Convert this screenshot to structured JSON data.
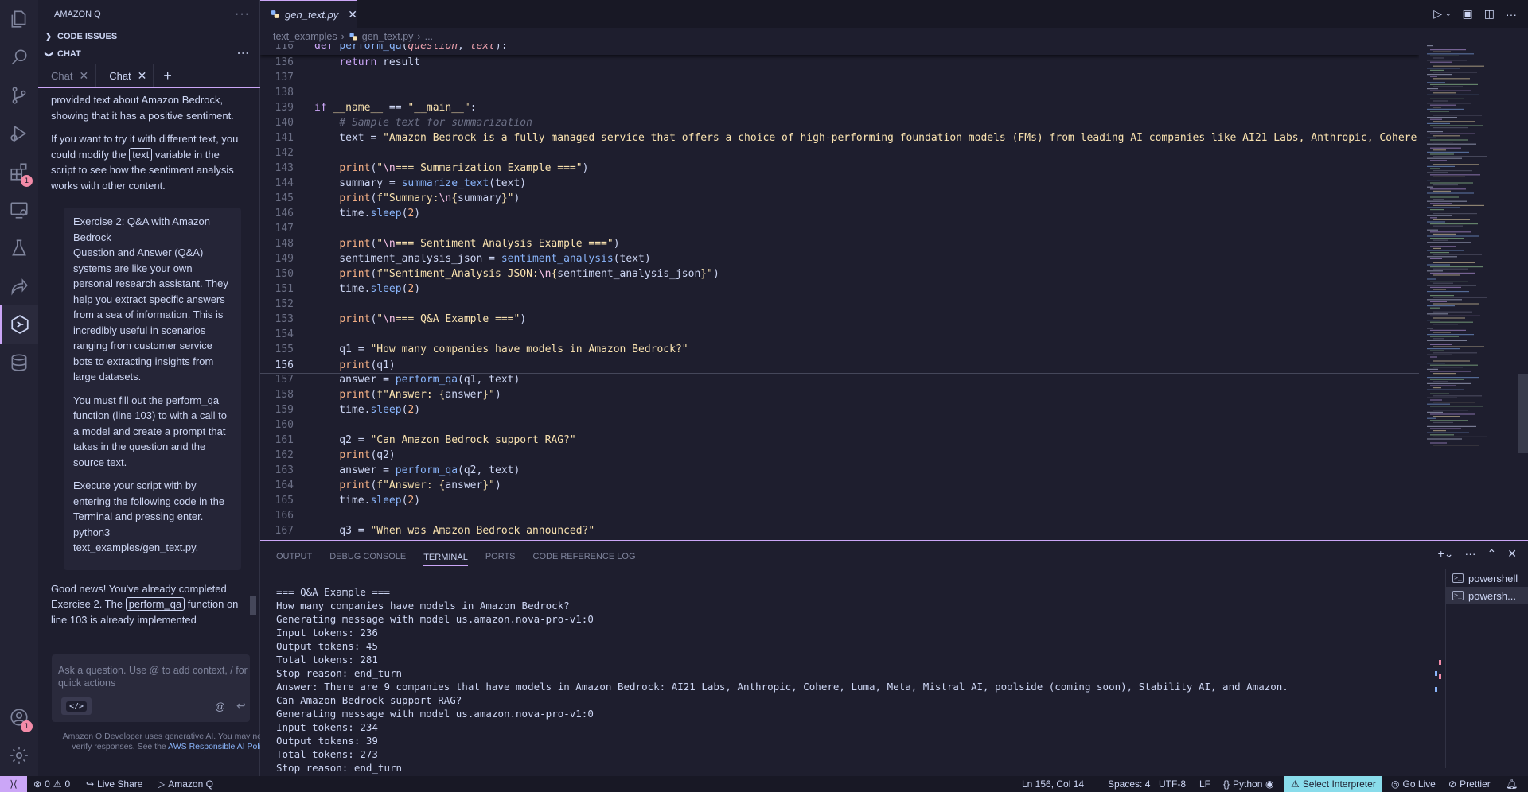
{
  "activity_bar": {
    "items": [
      {
        "name": "explorer-icon"
      },
      {
        "name": "search-icon"
      },
      {
        "name": "source-control-icon"
      },
      {
        "name": "run-debug-icon"
      },
      {
        "name": "extensions-icon",
        "badge": "1"
      },
      {
        "name": "remote-explorer-icon"
      },
      {
        "name": "testing-icon"
      },
      {
        "name": "live-share-icon"
      },
      {
        "name": "amazon-q-icon",
        "active": true
      },
      {
        "name": "database-icon"
      }
    ],
    "account_badge": "1"
  },
  "side_panel": {
    "title": "AMAZON Q",
    "sections": {
      "code_issues": "CODE ISSUES",
      "chat": "CHAT"
    },
    "chat_tabs": [
      {
        "label": "Chat"
      },
      {
        "label": "Chat"
      }
    ],
    "messages": {
      "m1": "provided text about Amazon Bedrock, showing that it has a positive sentiment.",
      "m2_pre": "If you want to try it with different text, you could modify the ",
      "m2_code": "text",
      "m2_post": " variable in the script to see how the sentiment analysis works with other content.",
      "quote_title": "Exercise 2: Q&A with Amazon Bedrock",
      "quote_p1": "Question and Answer (Q&A) systems are like your own personal research assistant. They help you extract specific answers from a sea of information. This is incredibly useful in scenarios ranging from customer service bots to extracting insights from large datasets.",
      "quote_p2": "You must fill out the perform_qa function (line 103) to with a call to a model and create a prompt that takes in the question and the source text.",
      "quote_p3a": "Execute your script with by entering the following code in the Terminal and pressing enter.",
      "quote_p3b": "python3",
      "quote_p3c": "text_examples/gen_text.py.",
      "m3_pre": "Good news! You've already completed Exercise 2. The ",
      "m3_code": "perform_qa",
      "m3_post": " function on line 103 is already implemented"
    },
    "input_placeholder": "Ask a question. Use @ to add context, / for quick actions",
    "code_button": "</>",
    "at_symbol": "@",
    "enter_symbol": "↩",
    "disclaimer_pre": "Amazon Q Developer uses generative AI. You may need to verify responses. See the ",
    "disclaimer_link": "AWS Responsible AI Policy",
    "disclaimer_post": "."
  },
  "editor": {
    "tab_label": "gen_text.py",
    "breadcrumb": [
      "text_examples",
      "gen_text.py",
      "..."
    ],
    "current_line": "156",
    "lines": [
      {
        "n": "116",
        "html": "<span class='kw'>def</span> <span class='fn'>perform_qa</span>(<span class='prm'>question</span>, <span class='prm'>text</span>):"
      },
      {
        "n": "136",
        "html": "    <span class='kw'>return</span> result"
      },
      {
        "n": "137",
        "html": ""
      },
      {
        "n": "138",
        "html": ""
      },
      {
        "n": "139",
        "html": "<span class='kw'>if</span> <span class='dunder'>__name__</span> == <span class='strw'>\"__main__\"</span>:"
      },
      {
        "n": "140",
        "html": "    <span class='cmt'># Sample text for summarization</span>"
      },
      {
        "n": "141",
        "html": "    text = <span class='strw'>\"Amazon Bedrock is a fully managed service that offers a choice of high-performing foundation models (FMs) from leading AI companies like AI21 Labs, Anthropic, Cohere, Luma, Meta, Mistral AI</span>"
      },
      {
        "n": "142",
        "html": ""
      },
      {
        "n": "143",
        "html": "    <span class='bi'>print</span>(<span class='strw'>\"<span class='esc'>\\n</span>=== Summarization Example ===\"</span>)"
      },
      {
        "n": "144",
        "html": "    summary = <span class='fn'>summarize_text</span>(text)"
      },
      {
        "n": "145",
        "html": "    <span class='bi'>print</span>(<span class='strw'>f\"Summary:<span class='esc'>\\n</span>{</span>summary<span class='strw'>}\"</span>)"
      },
      {
        "n": "146",
        "html": "    time.<span class='fn'>sleep</span>(<span class='num2'>2</span>)"
      },
      {
        "n": "147",
        "html": ""
      },
      {
        "n": "148",
        "html": "    <span class='bi'>print</span>(<span class='strw'>\"<span class='esc'>\\n</span>=== Sentiment Analysis Example ===\"</span>)"
      },
      {
        "n": "149",
        "html": "    sentiment_analysis_json = <span class='fn'>sentiment_analysis</span>(text)"
      },
      {
        "n": "150",
        "html": "    <span class='bi'>print</span>(<span class='strw'>f\"Sentiment_Analysis JSON:<span class='esc'>\\n</span>{</span>sentiment_analysis_json<span class='strw'>}\"</span>)"
      },
      {
        "n": "151",
        "html": "    time.<span class='fn'>sleep</span>(<span class='num2'>2</span>)"
      },
      {
        "n": "152",
        "html": ""
      },
      {
        "n": "153",
        "html": "    <span class='bi'>print</span>(<span class='strw'>\"<span class='esc'>\\n</span>=== Q&amp;A Example ===\"</span>)"
      },
      {
        "n": "154",
        "html": ""
      },
      {
        "n": "155",
        "html": "    q1 = <span class='strw'>\"How many companies have models in Amazon Bedrock?\"</span>"
      },
      {
        "n": "156",
        "html": "    <span class='bi'>print</span>(q1)"
      },
      {
        "n": "157",
        "html": "    answer = <span class='fn'>perform_qa</span>(q1, text)"
      },
      {
        "n": "158",
        "html": "    <span class='bi'>print</span>(<span class='strw'>f\"Answer: {</span>answer<span class='strw'>}\"</span>)"
      },
      {
        "n": "159",
        "html": "    time.<span class='fn'>sleep</span>(<span class='num2'>2</span>)"
      },
      {
        "n": "160",
        "html": ""
      },
      {
        "n": "161",
        "html": "    q2 = <span class='strw'>\"Can Amazon Bedrock support RAG?\"</span>"
      },
      {
        "n": "162",
        "html": "    <span class='bi'>print</span>(q2)"
      },
      {
        "n": "163",
        "html": "    answer = <span class='fn'>perform_qa</span>(q2, text)"
      },
      {
        "n": "164",
        "html": "    <span class='bi'>print</span>(<span class='strw'>f\"Answer: {</span>answer<span class='strw'>}\"</span>)"
      },
      {
        "n": "165",
        "html": "    time.<span class='fn'>sleep</span>(<span class='num2'>2</span>)"
      },
      {
        "n": "166",
        "html": ""
      },
      {
        "n": "167",
        "html": "    q3 = <span class='strw'>\"When was Amazon Bedrock announced?\"</span>"
      }
    ]
  },
  "panel": {
    "tabs": [
      "OUTPUT",
      "DEBUG CONSOLE",
      "TERMINAL",
      "PORTS",
      "CODE REFERENCE LOG"
    ],
    "active_tab": "TERMINAL",
    "terminal_lines": [
      "=== Q&A Example ===",
      "How many companies have models in Amazon Bedrock?",
      "Generating message with model us.amazon.nova-pro-v1:0",
      "Input tokens: 236",
      "Output tokens: 45",
      "Total tokens: 281",
      "Stop reason: end_turn",
      "Answer: There are 9 companies that have models in Amazon Bedrock: AI21 Labs, Anthropic, Cohere, Luma, Meta, Mistral AI, poolside (coming soon), Stability AI, and Amazon.",
      "Can Amazon Bedrock support RAG?",
      "Generating message with model us.amazon.nova-pro-v1:0",
      "Input tokens: 234",
      "Output tokens: 39",
      "Total tokens: 273",
      "Stop reason: end_turn"
    ],
    "terminals": [
      {
        "label": "powershell"
      },
      {
        "label": "powersh..."
      }
    ]
  },
  "status_bar": {
    "problems": "0",
    "warnings": "0",
    "live_share": "Live Share",
    "amazon_q": "Amazon Q",
    "position": "Ln 156, Col 14",
    "spaces": "Spaces: 4",
    "encoding": "UTF-8",
    "eol": "LF",
    "language": "Python",
    "interpreter": "Select Interpreter",
    "go_live": "Go Live",
    "prettier": "Prettier"
  },
  "colors": {
    "accent": "#cba6f7",
    "interpreter_bg": "#89dceb",
    "badge": "#f38ba8"
  }
}
